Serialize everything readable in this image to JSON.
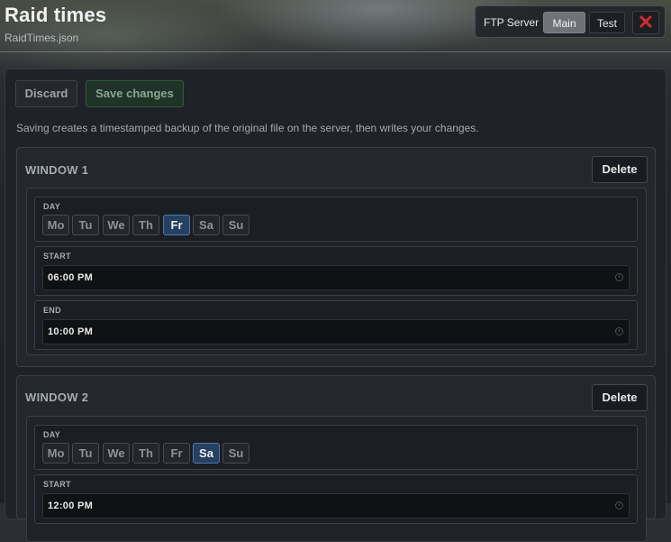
{
  "header": {
    "title": "Raid times",
    "subtitle": "RaidTimes.json"
  },
  "server": {
    "label": "FTP Server",
    "options": [
      "Main",
      "Test"
    ],
    "selected": "Main",
    "close_icon": "✕"
  },
  "toolbar": {
    "discard_label": "Discard",
    "save_label": "Save changes",
    "info": "Saving creates a timestamped backup of the original file on the server, then writes your changes."
  },
  "day_labels": [
    "Mo",
    "Tu",
    "We",
    "Th",
    "Fr",
    "Sa",
    "Su"
  ],
  "windows": [
    {
      "title": "WINDOW 1",
      "delete_label": "Delete",
      "day_label": "DAY",
      "selected_day": "Fr",
      "start_label": "START",
      "start_value": "06:00 PM",
      "end_label": "END",
      "end_value": "10:00 PM"
    },
    {
      "title": "WINDOW 2",
      "delete_label": "Delete",
      "day_label": "DAY",
      "selected_day": "Sa",
      "start_label": "START",
      "start_value": "12:00 PM"
    }
  ],
  "colors": {
    "accent_day": "#26405f",
    "save_green": "#2f5a3d",
    "close_red": "#d52a2a"
  }
}
